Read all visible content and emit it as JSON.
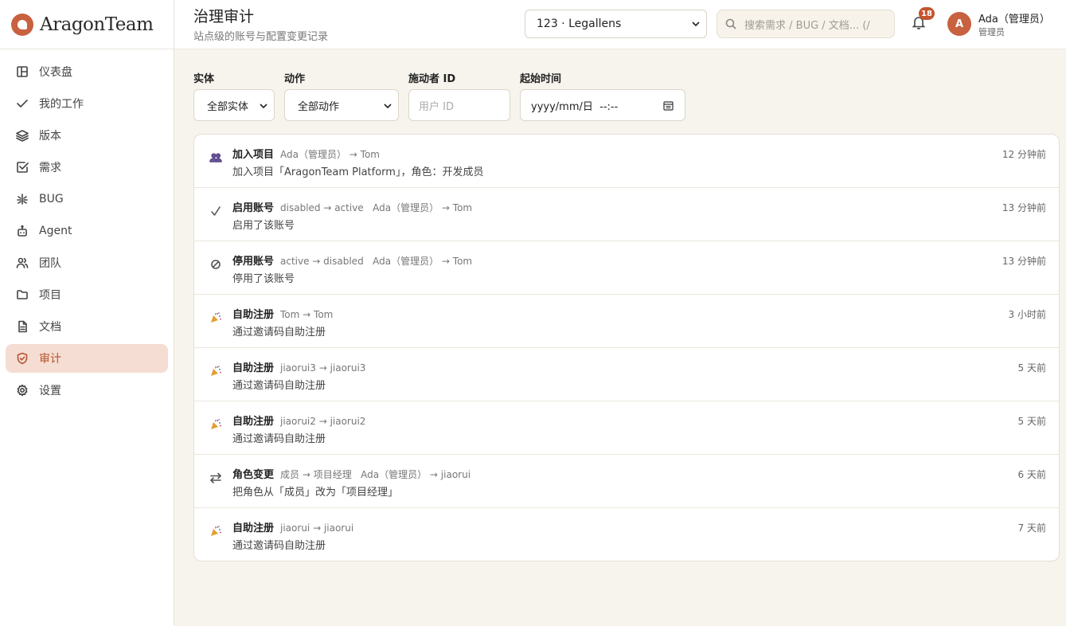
{
  "brand": {
    "name": "AragonTeam"
  },
  "sidebar": {
    "items": [
      {
        "label": "仪表盘",
        "icon": "dashboard-icon",
        "active": false
      },
      {
        "label": "我的工作",
        "icon": "check-icon",
        "active": false
      },
      {
        "label": "版本",
        "icon": "layers-icon",
        "active": false
      },
      {
        "label": "需求",
        "icon": "checkbox-icon",
        "active": false
      },
      {
        "label": "BUG",
        "icon": "bug-icon",
        "active": false
      },
      {
        "label": "Agent",
        "icon": "robot-icon",
        "active": false
      },
      {
        "label": "团队",
        "icon": "users-icon",
        "active": false
      },
      {
        "label": "项目",
        "icon": "folder-icon",
        "active": false
      },
      {
        "label": "文档",
        "icon": "document-icon",
        "active": false
      },
      {
        "label": "审计",
        "icon": "shield-icon",
        "active": true
      },
      {
        "label": "设置",
        "icon": "gear-icon",
        "active": false
      }
    ]
  },
  "header": {
    "title": "治理审计",
    "subtitle": "站点级的账号与配置变更记录",
    "project_select": "123 · Legallens",
    "search_placeholder": "搜索需求 / BUG / 文档...  (/",
    "notification_count": "18",
    "user": {
      "initial": "A",
      "name": "Ada（管理员）",
      "role": "管理员"
    }
  },
  "filters": {
    "entity": {
      "label": "实体",
      "value": "全部实体"
    },
    "action": {
      "label": "动作",
      "value": "全部动作"
    },
    "actor": {
      "label": "施动者 ID",
      "placeholder": "用户 ID"
    },
    "start": {
      "label": "起始时间",
      "value": "yyyy/mm/日  --:--"
    }
  },
  "events": [
    {
      "icon": "users-icon",
      "action": "加入项目",
      "meta": "Ada（管理员） → Tom",
      "detail": "加入项目「AragonTeam Platform」，角色：开发成员",
      "time": "12 分钟前"
    },
    {
      "icon": "check-icon",
      "action": "启用账号",
      "meta": "disabled → active   Ada（管理员） → Tom",
      "detail": "启用了该账号",
      "time": "13 分钟前"
    },
    {
      "icon": "ban-icon",
      "action": "停用账号",
      "meta": "active → disabled   Ada（管理员） → Tom",
      "detail": "停用了该账号",
      "time": "13 分钟前"
    },
    {
      "icon": "party-icon",
      "action": "自助注册",
      "meta": "Tom → Tom",
      "detail": "通过邀请码自助注册",
      "time": "3 小时前"
    },
    {
      "icon": "party-icon",
      "action": "自助注册",
      "meta": "jiaorui3 → jiaorui3",
      "detail": "通过邀请码自助注册",
      "time": "5 天前"
    },
    {
      "icon": "party-icon",
      "action": "自助注册",
      "meta": "jiaorui2 → jiaorui2",
      "detail": "通过邀请码自助注册",
      "time": "5 天前"
    },
    {
      "icon": "swap-icon",
      "action": "角色变更",
      "meta": "成员 → 项目经理   Ada（管理员） → jiaorui",
      "detail": "把角色从「成员」改为「项目经理」",
      "time": "6 天前"
    },
    {
      "icon": "party-icon",
      "action": "自助注册",
      "meta": "jiaorui → jiaorui",
      "detail": "通过邀请码自助注册",
      "time": "7 天前"
    }
  ],
  "colors": {
    "accent": "#c8613f",
    "active_bg": "#f5ddd3",
    "page_bg": "#f7f4ee"
  }
}
